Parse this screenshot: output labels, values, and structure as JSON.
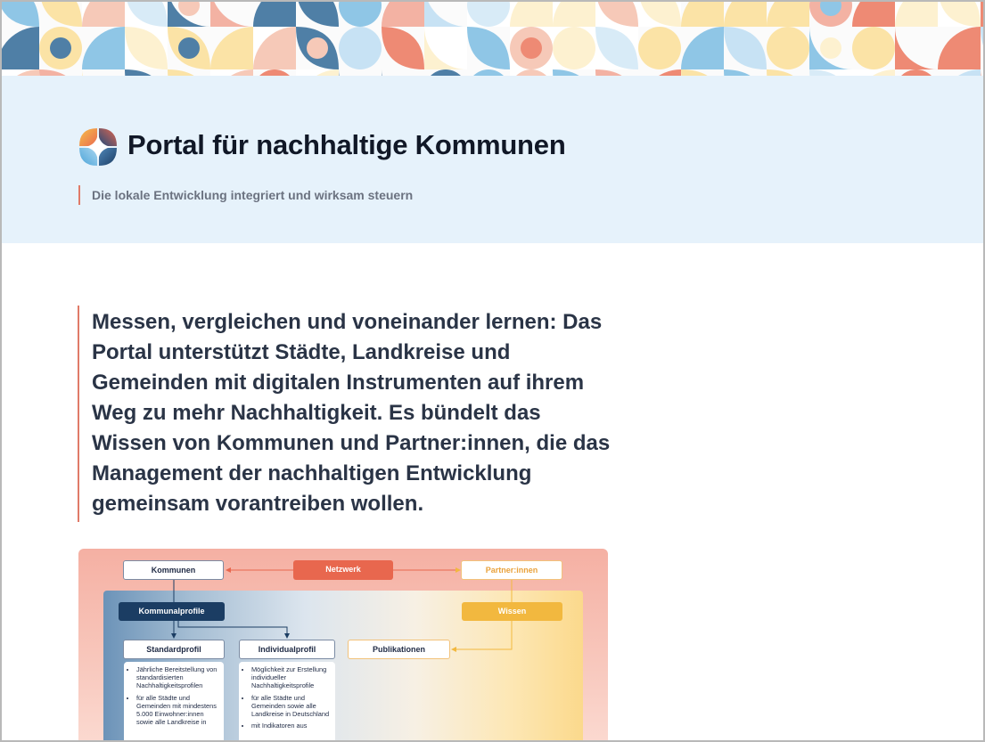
{
  "header": {
    "title": "Portal für nachhaltige Kommunen",
    "tagline": "Die lokale Entwicklung integriert und wirksam steuern",
    "logo_icon": "portal-logo-icon",
    "background": "#e6f2fb"
  },
  "intro": {
    "text": "Messen, vergleichen und voneinander lernen: Das Portal unterstützt Städte, Landkreise und Gemeinden mit digitalen Instrumenten auf ihrem Weg zu mehr Nachhaltigkeit. Es bündelt das Wissen von Kommunen und Partner:innen, die das Management der nachhaltigen Entwicklung gemeinsam vorantreiben wollen."
  },
  "diagram": {
    "kommunen": "Kommunen",
    "netzwerk": "Netzwerk",
    "partner": "Partner:innen",
    "kommunalprofile": "Kommunalprofile",
    "wissen": "Wissen",
    "standardprofil": "Standardprofil",
    "individualprofil": "Individualprofil",
    "publikationen": "Publikationen",
    "standard_points": [
      "Jährliche Bereitstellung von standardisierten Nachhaltigkeitsprofilen",
      "für alle Städte und Gemeinden mit mindestens 5.000 Einwohner:innen sowie alle Landkreise in"
    ],
    "individual_points": [
      "Möglichkeit zur Erstellung individueller Nachhaltigkeitsprofile",
      "für alle Städte und Gemeinden sowie alle Landkreise in Deutschland",
      "mit Indikatoren aus"
    ]
  },
  "colors": {
    "accent": "#e07a68",
    "netzwerk": "#e8674e",
    "kommunalprofile": "#1b3d63",
    "wissen": "#f2b83f",
    "title": "#111827"
  }
}
